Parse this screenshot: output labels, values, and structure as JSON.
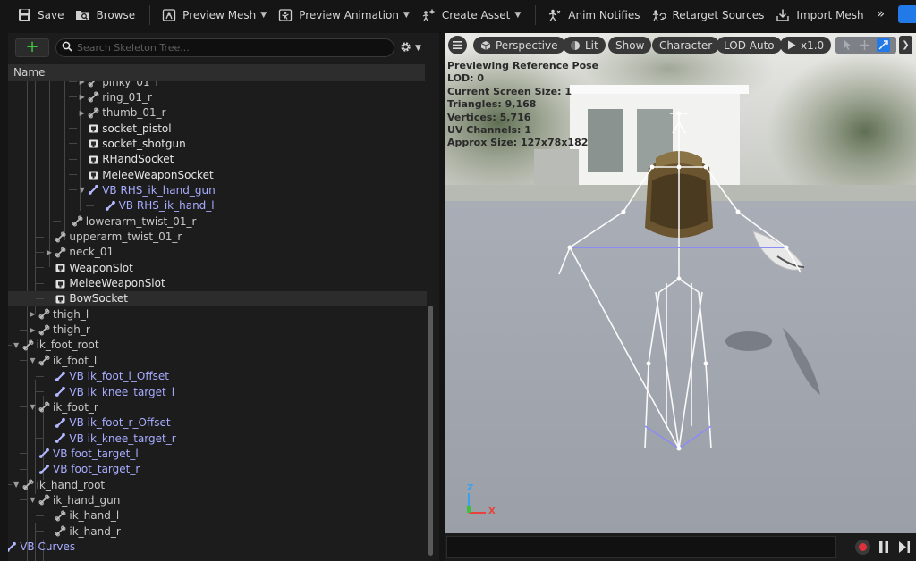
{
  "toolbar": {
    "save": "Save",
    "browse": "Browse",
    "preview_mesh": "Preview Mesh",
    "preview_animation": "Preview Animation",
    "create_asset": "Create Asset",
    "anim_notifies": "Anim Notifies",
    "retarget_sources": "Retarget Sources",
    "import_mesh": "Import Mesh"
  },
  "skeleton_tree": {
    "search_placeholder": "Search Skeleton Tree...",
    "column_name": "Name",
    "rows": [
      {
        "label": "pinky_01_r",
        "indent": 3,
        "type": "bone",
        "expand": "collapsed"
      },
      {
        "label": "ring_01_r",
        "indent": 3,
        "type": "bone",
        "expand": "collapsed"
      },
      {
        "label": "thumb_01_r",
        "indent": 3,
        "type": "bone",
        "expand": "collapsed"
      },
      {
        "label": "socket_pistol",
        "indent": 3,
        "type": "socket",
        "expand": "none"
      },
      {
        "label": "socket_shotgun",
        "indent": 3,
        "type": "socket",
        "expand": "none"
      },
      {
        "label": "RHandSocket",
        "indent": 3,
        "type": "socket",
        "expand": "none"
      },
      {
        "label": "MeleeWeaponSocket",
        "indent": 3,
        "type": "socket",
        "expand": "none"
      },
      {
        "label": "VB RHS_ik_hand_gun",
        "indent": 3,
        "type": "vb",
        "expand": "expanded"
      },
      {
        "label": "VB RHS_ik_hand_l",
        "indent": 4,
        "type": "vb",
        "expand": "none"
      },
      {
        "label": "lowerarm_twist_01_r",
        "indent": 2,
        "type": "bone",
        "expand": "none"
      },
      {
        "label": "upperarm_twist_01_r",
        "indent": 1,
        "type": "bone",
        "expand": "none"
      },
      {
        "label": "neck_01",
        "indent": 1,
        "type": "bone",
        "expand": "collapsed"
      },
      {
        "label": "WeaponSlot",
        "indent": 1,
        "type": "socket",
        "expand": "none"
      },
      {
        "label": "MeleeWeaponSlot",
        "indent": 1,
        "type": "socket",
        "expand": "none"
      },
      {
        "label": "BowSocket",
        "indent": 1,
        "type": "socket",
        "expand": "none",
        "selected": true
      },
      {
        "label": "thigh_l",
        "indent": 0,
        "type": "bone",
        "expand": "collapsed"
      },
      {
        "label": "thigh_r",
        "indent": 0,
        "type": "bone",
        "expand": "collapsed"
      },
      {
        "label": "ik_foot_root",
        "indent": -1,
        "type": "bone",
        "expand": "expanded"
      },
      {
        "label": "ik_foot_l",
        "indent": 0,
        "type": "bone",
        "expand": "expanded"
      },
      {
        "label": "VB ik_foot_l_Offset",
        "indent": 1,
        "type": "vb",
        "expand": "none"
      },
      {
        "label": "VB ik_knee_target_l",
        "indent": 1,
        "type": "vb",
        "expand": "none"
      },
      {
        "label": "ik_foot_r",
        "indent": 0,
        "type": "bone",
        "expand": "expanded"
      },
      {
        "label": "VB ik_foot_r_Offset",
        "indent": 1,
        "type": "vb",
        "expand": "none"
      },
      {
        "label": "VB ik_knee_target_r",
        "indent": 1,
        "type": "vb",
        "expand": "none"
      },
      {
        "label": "VB foot_target_l",
        "indent": 0,
        "type": "vb",
        "expand": "none"
      },
      {
        "label": "VB foot_target_r",
        "indent": 0,
        "type": "vb",
        "expand": "none"
      },
      {
        "label": "ik_hand_root",
        "indent": -1,
        "type": "bone",
        "expand": "expanded"
      },
      {
        "label": "ik_hand_gun",
        "indent": 0,
        "type": "bone",
        "expand": "expanded"
      },
      {
        "label": "ik_hand_l",
        "indent": 1,
        "type": "bone",
        "expand": "none"
      },
      {
        "label": "ik_hand_r",
        "indent": 1,
        "type": "bone",
        "expand": "none"
      },
      {
        "label": "VB Curves",
        "indent": -2,
        "type": "vb",
        "expand": "none"
      }
    ]
  },
  "viewport": {
    "perspective": "Perspective",
    "lit": "Lit",
    "show": "Show",
    "character": "Character",
    "lod": "LOD Auto",
    "play_rate": "x1.0",
    "stats": [
      "Previewing Reference Pose",
      "LOD: 0",
      "Current Screen Size: 1",
      "Triangles: 9,168",
      "Vertices: 5,716",
      "UV Channels: 1",
      "Approx Size: 127x78x182"
    ],
    "axis_z": "Z",
    "axis_x": "X"
  },
  "colors": {
    "accent_blue": "#2279e8",
    "vb_text": "#a7acff",
    "record_red": "#e0303a",
    "add_green": "#3fc43f"
  }
}
